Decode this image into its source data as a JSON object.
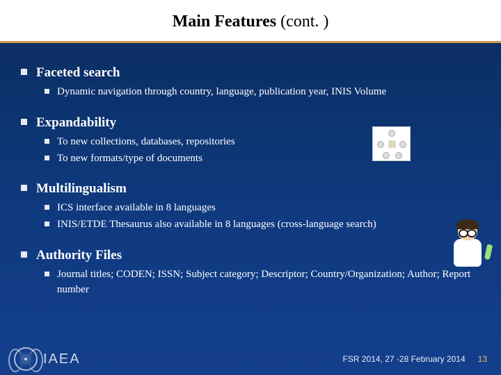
{
  "title_bold": "Main Features",
  "title_rest": " (cont. )",
  "sections": [
    {
      "heading": "Faceted search",
      "items": [
        "Dynamic navigation through country, language, publication year, INIS Volume"
      ]
    },
    {
      "heading": "Expandability",
      "items": [
        "To new collections, databases, repositories",
        "To new formats/type of documents"
      ]
    },
    {
      "heading": "Multilingualism",
      "items": [
        "ICS interface available in 8 languages",
        "INIS/ETDE Thesaurus also available in 8 languages (cross-language search)"
      ]
    },
    {
      "heading": "Authority Files",
      "items": [
        "Journal titles; CODEN; ISSN; Subject category; Descriptor; Country/Organization; Author; Report number"
      ]
    }
  ],
  "footer": {
    "org": "IAEA",
    "event": "FSR 2014, 27 -28 February 2014",
    "page": "13"
  }
}
